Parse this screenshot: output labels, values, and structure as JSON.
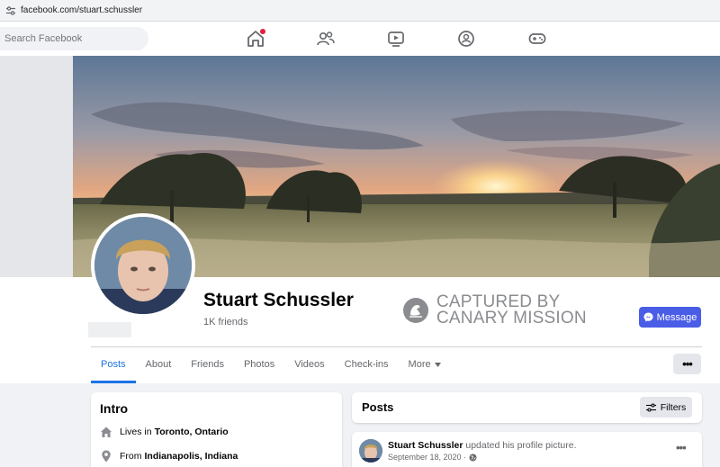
{
  "browser": {
    "url": "facebook.com/stuart.schussler"
  },
  "topnav": {
    "search_placeholder": "Search Facebook",
    "icons": [
      "home-icon",
      "friends-icon",
      "watch-icon",
      "groups-icon",
      "gaming-icon"
    ],
    "notification_color": "#e41e3f"
  },
  "profile": {
    "name": "Stuart Schussler",
    "friends": "1K friends",
    "message_label": "Message"
  },
  "watermark": {
    "line1": "CAPTURED BY",
    "line2": "CANARY MISSION"
  },
  "tabs": [
    {
      "label": "Posts",
      "active": true
    },
    {
      "label": "About"
    },
    {
      "label": "Friends"
    },
    {
      "label": "Photos"
    },
    {
      "label": "Videos"
    },
    {
      "label": "Check-ins"
    },
    {
      "label": "More"
    }
  ],
  "more_actions": "•••",
  "intro": {
    "title": "Intro",
    "lives_prefix": "Lives in",
    "lives_value": "Toronto, Ontario",
    "from_prefix": "From",
    "from_value": "Indianapolis, Indiana"
  },
  "posts": {
    "title": "Posts",
    "filters_label": "Filters",
    "first": {
      "author": "Stuart Schussler",
      "action": " updated his profile picture.",
      "date": "September 18, 2020 ·",
      "menu": "•••"
    }
  },
  "colors": {
    "accent": "#1b74e4",
    "message_button": "#4a5de6"
  }
}
